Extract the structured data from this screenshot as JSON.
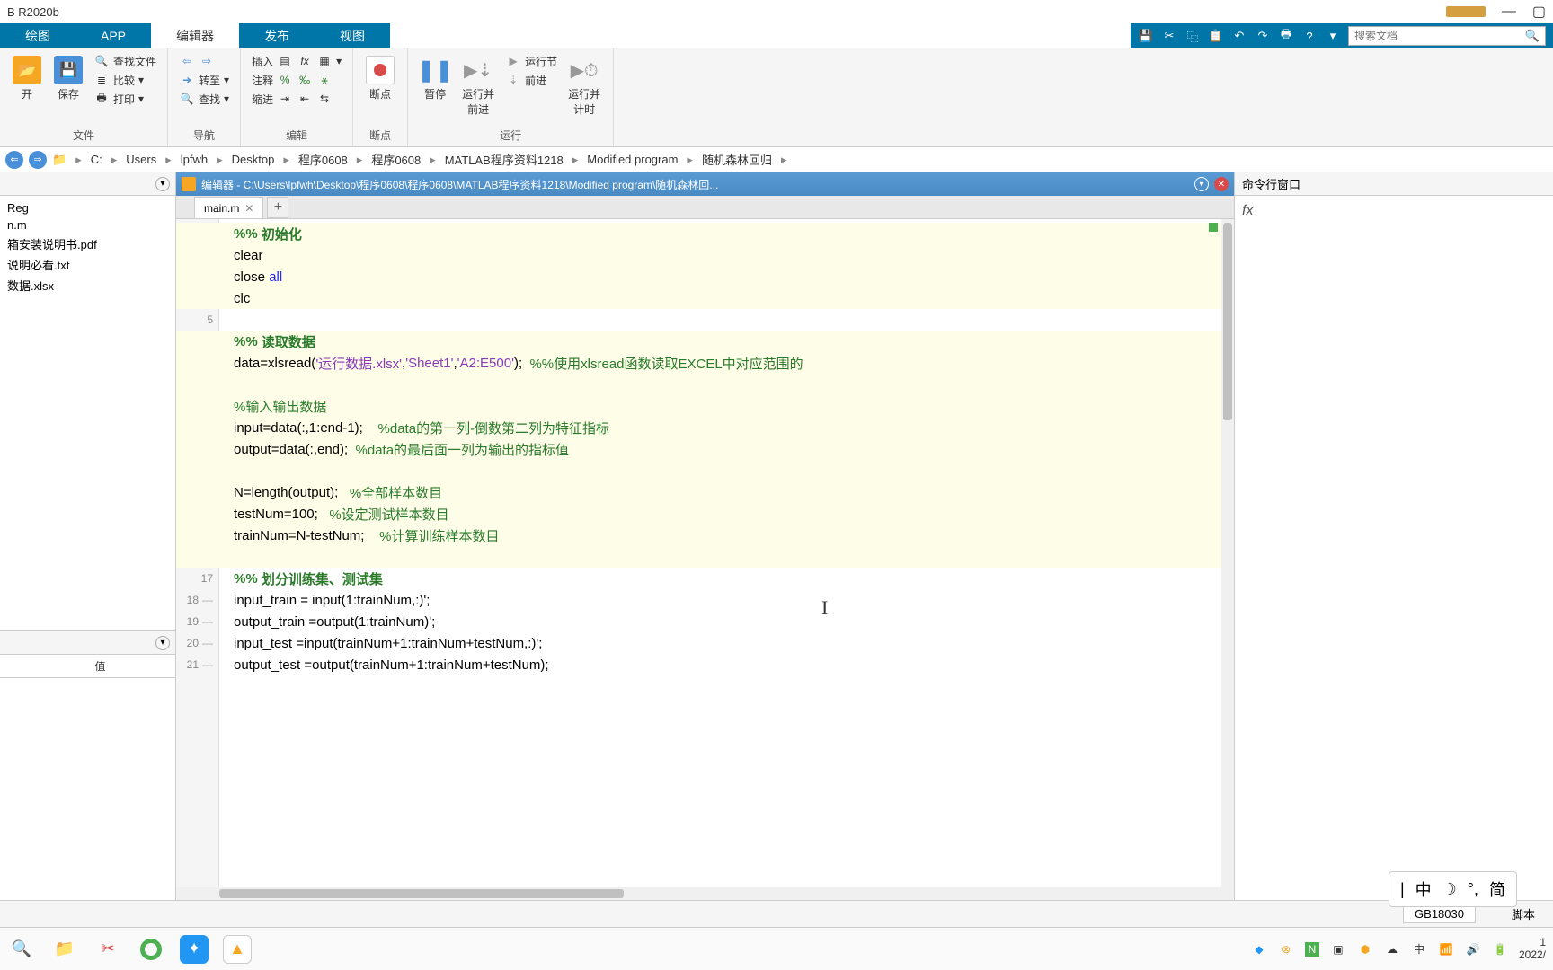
{
  "titlebar": {
    "app": "B R2020b"
  },
  "tabs": {
    "t1": "绘图",
    "t2": "APP",
    "t3": "编辑器",
    "t4": "发布",
    "t5": "视图"
  },
  "search": {
    "placeholder": "搜索文档"
  },
  "ribbon": {
    "file": {
      "label": "文件",
      "open": "开",
      "save": "保存",
      "find_files": "查找文件",
      "compare": "比较",
      "print": "打印"
    },
    "nav": {
      "label": "导航",
      "goto": "转至",
      "find": "查找"
    },
    "edit": {
      "label": "编辑",
      "insert": "插入",
      "comment": "注释",
      "indent": "缩进"
    },
    "bp": {
      "label": "断点",
      "big": "断点"
    },
    "run": {
      "label": "运行",
      "pause": "暂停",
      "run_adv": "运行并\n前进",
      "run_sec": "运行节",
      "step": "前进",
      "run_time": "运行并\n计时"
    }
  },
  "path": {
    "root": "C:",
    "p1": "Users",
    "p2": "lpfwh",
    "p3": "Desktop",
    "p4": "程序0608",
    "p5": "程序0608",
    "p6": "MATLAB程序资料1218",
    "p7": "Modified program",
    "p8": "随机森林回归"
  },
  "files": {
    "f1": "Reg",
    "f2": "n.m",
    "f3": "箱安装说明书.pdf",
    "f4": "说明必看.txt",
    "f5": "数据.xlsx"
  },
  "workspace": {
    "col1": "",
    "col2": "值"
  },
  "editor": {
    "title": "编辑器 - C:\\Users\\lpfwh\\Desktop\\程序0608\\程序0608\\MATLAB程序资料1218\\Modified program\\随机森林回...",
    "tab": "main.m"
  },
  "code": {
    "l1a": "%% ",
    "l1b": "初始化",
    "l2a": "clear",
    "l3a": "close ",
    "l3b": "all",
    "l4a": "clc",
    "l6a": "%% ",
    "l6b": "读取数据",
    "l7a": "data=xlsread(",
    "l7b": "'运行数据.xlsx'",
    "l7c": ",",
    "l7d": "'Sheet1'",
    "l7e": ",",
    "l7f": "'A2:E500'",
    "l7g": ");  ",
    "l7h": "%%使用xlsread函数读取EXCEL中对应范围的",
    "l9a": "%输入输出数据",
    "l10a": "input=data(:,1:end-1);    ",
    "l10b": "%data的第一列-倒数第二列为特征指标",
    "l11a": "output=data(:,end);  ",
    "l11b": "%data的最后面一列为输出的指标值",
    "l13a": "N=length(output);   ",
    "l13b": "%全部样本数目",
    "l14a": "testNum=100;   ",
    "l14b": "%设定测试样本数目",
    "l15a": "trainNum=N-testNum;    ",
    "l15b": "%计算训练样本数目",
    "l17a": "%% ",
    "l17b": "划分训练集、测试集",
    "l18a": "input_train = input(1:trainNum,:)';",
    "l19a": "output_train =output(1:trainNum)';",
    "l20a": "input_test =input(trainNum+1:trainNum+testNum,:)';",
    "l21a": "output_test =output(trainNum+1:trainNum+testNum);"
  },
  "cmd": {
    "title": "命令行窗口",
    "fx": "fx"
  },
  "status": {
    "enc": "GB18030",
    "type": "脚本"
  },
  "ime": {
    "i1": "中",
    "i2": "简"
  },
  "clock": {
    "t": "1",
    "d": "2022/"
  }
}
